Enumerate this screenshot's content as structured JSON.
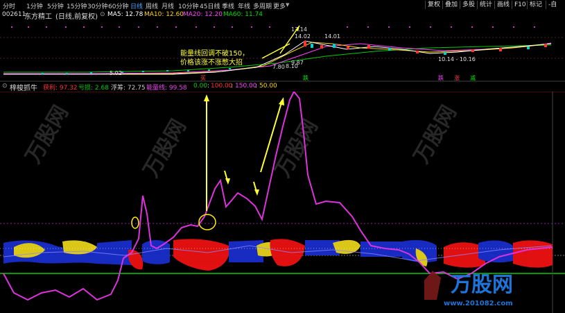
{
  "toolbar": {
    "periods": [
      "分时",
      "1分钟",
      "5分钟",
      "15分钟",
      "30分钟",
      "60分钟",
      "日线",
      "周线",
      "月线",
      "10分钟",
      "45日线",
      "季线",
      "年线",
      "多周期",
      "更多"
    ],
    "active_period": "日线",
    "right_buttons": [
      "复权",
      "叠加",
      "多股",
      "统计",
      "画线",
      "F10",
      "标记",
      "-自"
    ]
  },
  "header": {
    "stock_code": "002611",
    "stock_name": "东方精工",
    "mode": "(日线,前复权)",
    "ma": [
      {
        "label": "MA5: 12.78",
        "color": "#ffffff"
      },
      {
        "label": "MA10: 12.60",
        "color": "#ffd700"
      },
      {
        "label": "MA20: 12.20",
        "color": "#ff44ff"
      },
      {
        "label": "MA60: 11.74",
        "color": "#00dd00"
      }
    ]
  },
  "price_chart": {
    "annotations": {
      "high_1": "17.14",
      "high_2": "14.02",
      "high_3": "14.01",
      "low_start": "5.02",
      "mid_1": "7.80",
      "mid_2": "8.10",
      "mid_3": "9.87",
      "range_right": "10.14 - 10.16"
    },
    "note_line1": "能量线回调不破150，",
    "note_line2": "价格该涨不涨憋大招",
    "signals": [
      "买",
      "跌",
      "跌",
      "跌",
      "涨",
      "减"
    ]
  },
  "indicator": {
    "name": "梓梭抓牛",
    "fields": [
      {
        "label": "获利: 97.32",
        "color": "#ff3333"
      },
      {
        "label": "亏损: 2.68",
        "color": "#00cc00"
      },
      {
        "label": "浮筹: 72.75",
        "color": "#cccccc"
      },
      {
        "label": "能量线: 99.58",
        "color": "#ee44ee"
      },
      {
        "label": "0.00",
        "color": "#00cc00"
      },
      {
        "label": "100.00",
        "color": "#ff3333"
      },
      {
        "label": "150.00",
        "color": "#ff44ff"
      },
      {
        "label": "50.00",
        "color": "#ffd700"
      }
    ]
  },
  "watermark": {
    "brand": "万股网",
    "url": "www.201082.com"
  }
}
